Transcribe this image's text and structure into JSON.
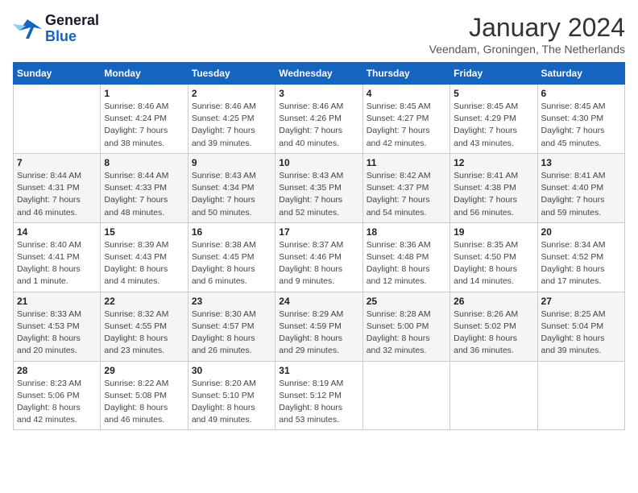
{
  "header": {
    "logo_general": "General",
    "logo_blue": "Blue",
    "month_year": "January 2024",
    "location": "Veendam, Groningen, The Netherlands"
  },
  "days_of_week": [
    "Sunday",
    "Monday",
    "Tuesday",
    "Wednesday",
    "Thursday",
    "Friday",
    "Saturday"
  ],
  "weeks": [
    [
      {
        "day": "",
        "info": ""
      },
      {
        "day": "1",
        "info": "Sunrise: 8:46 AM\nSunset: 4:24 PM\nDaylight: 7 hours\nand 38 minutes."
      },
      {
        "day": "2",
        "info": "Sunrise: 8:46 AM\nSunset: 4:25 PM\nDaylight: 7 hours\nand 39 minutes."
      },
      {
        "day": "3",
        "info": "Sunrise: 8:46 AM\nSunset: 4:26 PM\nDaylight: 7 hours\nand 40 minutes."
      },
      {
        "day": "4",
        "info": "Sunrise: 8:45 AM\nSunset: 4:27 PM\nDaylight: 7 hours\nand 42 minutes."
      },
      {
        "day": "5",
        "info": "Sunrise: 8:45 AM\nSunset: 4:29 PM\nDaylight: 7 hours\nand 43 minutes."
      },
      {
        "day": "6",
        "info": "Sunrise: 8:45 AM\nSunset: 4:30 PM\nDaylight: 7 hours\nand 45 minutes."
      }
    ],
    [
      {
        "day": "7",
        "info": "Sunrise: 8:44 AM\nSunset: 4:31 PM\nDaylight: 7 hours\nand 46 minutes."
      },
      {
        "day": "8",
        "info": "Sunrise: 8:44 AM\nSunset: 4:33 PM\nDaylight: 7 hours\nand 48 minutes."
      },
      {
        "day": "9",
        "info": "Sunrise: 8:43 AM\nSunset: 4:34 PM\nDaylight: 7 hours\nand 50 minutes."
      },
      {
        "day": "10",
        "info": "Sunrise: 8:43 AM\nSunset: 4:35 PM\nDaylight: 7 hours\nand 52 minutes."
      },
      {
        "day": "11",
        "info": "Sunrise: 8:42 AM\nSunset: 4:37 PM\nDaylight: 7 hours\nand 54 minutes."
      },
      {
        "day": "12",
        "info": "Sunrise: 8:41 AM\nSunset: 4:38 PM\nDaylight: 7 hours\nand 56 minutes."
      },
      {
        "day": "13",
        "info": "Sunrise: 8:41 AM\nSunset: 4:40 PM\nDaylight: 7 hours\nand 59 minutes."
      }
    ],
    [
      {
        "day": "14",
        "info": "Sunrise: 8:40 AM\nSunset: 4:41 PM\nDaylight: 8 hours\nand 1 minute."
      },
      {
        "day": "15",
        "info": "Sunrise: 8:39 AM\nSunset: 4:43 PM\nDaylight: 8 hours\nand 4 minutes."
      },
      {
        "day": "16",
        "info": "Sunrise: 8:38 AM\nSunset: 4:45 PM\nDaylight: 8 hours\nand 6 minutes."
      },
      {
        "day": "17",
        "info": "Sunrise: 8:37 AM\nSunset: 4:46 PM\nDaylight: 8 hours\nand 9 minutes."
      },
      {
        "day": "18",
        "info": "Sunrise: 8:36 AM\nSunset: 4:48 PM\nDaylight: 8 hours\nand 12 minutes."
      },
      {
        "day": "19",
        "info": "Sunrise: 8:35 AM\nSunset: 4:50 PM\nDaylight: 8 hours\nand 14 minutes."
      },
      {
        "day": "20",
        "info": "Sunrise: 8:34 AM\nSunset: 4:52 PM\nDaylight: 8 hours\nand 17 minutes."
      }
    ],
    [
      {
        "day": "21",
        "info": "Sunrise: 8:33 AM\nSunset: 4:53 PM\nDaylight: 8 hours\nand 20 minutes."
      },
      {
        "day": "22",
        "info": "Sunrise: 8:32 AM\nSunset: 4:55 PM\nDaylight: 8 hours\nand 23 minutes."
      },
      {
        "day": "23",
        "info": "Sunrise: 8:30 AM\nSunset: 4:57 PM\nDaylight: 8 hours\nand 26 minutes."
      },
      {
        "day": "24",
        "info": "Sunrise: 8:29 AM\nSunset: 4:59 PM\nDaylight: 8 hours\nand 29 minutes."
      },
      {
        "day": "25",
        "info": "Sunrise: 8:28 AM\nSunset: 5:00 PM\nDaylight: 8 hours\nand 32 minutes."
      },
      {
        "day": "26",
        "info": "Sunrise: 8:26 AM\nSunset: 5:02 PM\nDaylight: 8 hours\nand 36 minutes."
      },
      {
        "day": "27",
        "info": "Sunrise: 8:25 AM\nSunset: 5:04 PM\nDaylight: 8 hours\nand 39 minutes."
      }
    ],
    [
      {
        "day": "28",
        "info": "Sunrise: 8:23 AM\nSunset: 5:06 PM\nDaylight: 8 hours\nand 42 minutes."
      },
      {
        "day": "29",
        "info": "Sunrise: 8:22 AM\nSunset: 5:08 PM\nDaylight: 8 hours\nand 46 minutes."
      },
      {
        "day": "30",
        "info": "Sunrise: 8:20 AM\nSunset: 5:10 PM\nDaylight: 8 hours\nand 49 minutes."
      },
      {
        "day": "31",
        "info": "Sunrise: 8:19 AM\nSunset: 5:12 PM\nDaylight: 8 hours\nand 53 minutes."
      },
      {
        "day": "",
        "info": ""
      },
      {
        "day": "",
        "info": ""
      },
      {
        "day": "",
        "info": ""
      }
    ]
  ]
}
